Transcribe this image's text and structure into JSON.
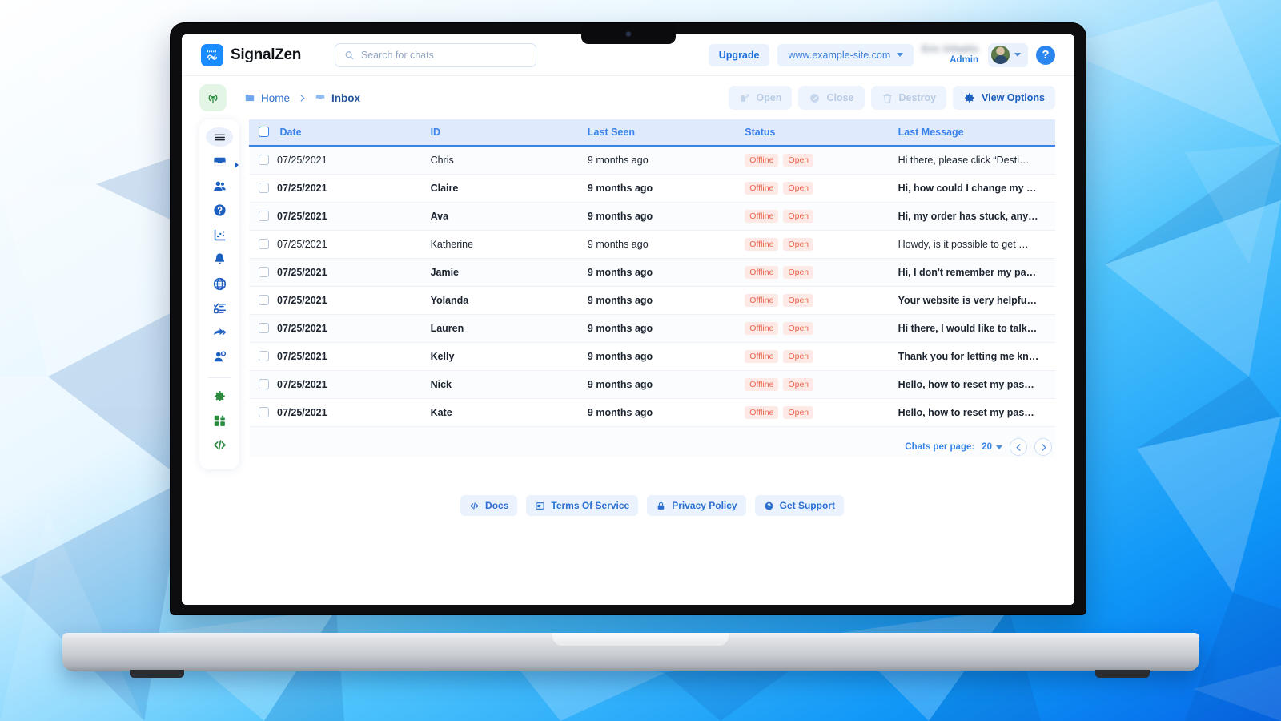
{
  "brand": {
    "name": "SignalZen",
    "logo_icon": "signalzen-logo-icon"
  },
  "search": {
    "placeholder": "Search for chats",
    "value": "",
    "icon": "search-icon"
  },
  "header": {
    "upgrade_label": "Upgrade",
    "site_label": "www.example-site.com",
    "user_name": "Eric Urbaitis",
    "user_role": "Admin",
    "help_label": "?",
    "avatar_icon": "user-avatar",
    "dropdown_icon": "chevron-down-icon"
  },
  "toolbar": {
    "signal_icon": "broadcast-signal-icon",
    "breadcrumb": [
      {
        "label": "Home",
        "icon": "folder-icon",
        "active": false
      },
      {
        "label": "Inbox",
        "icon": "inbox-icon",
        "active": true
      }
    ],
    "separator": "›",
    "actions": [
      {
        "label": "Open",
        "icon": "open-external-icon",
        "enabled": false
      },
      {
        "label": "Close",
        "icon": "check-circle-icon",
        "enabled": false
      },
      {
        "label": "Destroy",
        "icon": "trash-icon",
        "enabled": false
      },
      {
        "label": "View Options",
        "icon": "gear-icon",
        "enabled": true
      }
    ]
  },
  "sidebar": {
    "items": [
      {
        "name": "menu",
        "icon": "hamburger-menu-icon",
        "active": true,
        "color": "#1c2430",
        "has_arrow": false
      },
      {
        "name": "inbox",
        "icon": "inbox-icon",
        "active": false,
        "color": "#1d5fc0",
        "has_arrow": true
      },
      {
        "name": "visitors",
        "icon": "users-icon",
        "active": false,
        "color": "#1d5fc0",
        "has_arrow": false
      },
      {
        "name": "help",
        "icon": "question-circle-icon",
        "active": false,
        "color": "#1d5fc0",
        "has_arrow": false
      },
      {
        "name": "analytics",
        "icon": "chart-scatter-icon",
        "active": false,
        "color": "#1d5fc0",
        "has_arrow": false
      },
      {
        "name": "notifications",
        "icon": "bell-icon",
        "active": false,
        "color": "#1d5fc0",
        "has_arrow": false
      },
      {
        "name": "website",
        "icon": "globe-icon",
        "active": false,
        "color": "#1d5fc0",
        "has_arrow": false
      },
      {
        "name": "tasks",
        "icon": "checklist-icon",
        "active": false,
        "color": "#1d5fc0",
        "has_arrow": false
      },
      {
        "name": "broadcast",
        "icon": "share-forward-icon",
        "active": false,
        "color": "#1d5fc0",
        "has_arrow": false
      },
      {
        "name": "agents",
        "icon": "user-settings-icon",
        "active": false,
        "color": "#1d5fc0",
        "has_arrow": false
      },
      {
        "name": "settings",
        "icon": "gear-icon",
        "active": false,
        "color": "#2c8a3f",
        "has_arrow": false
      },
      {
        "name": "integrations",
        "icon": "puzzle-apps-icon",
        "active": false,
        "color": "#2c8a3f",
        "has_arrow": false
      },
      {
        "name": "developers",
        "icon": "code-icon",
        "active": false,
        "color": "#2c8a3f",
        "has_arrow": false
      }
    ]
  },
  "table": {
    "columns": [
      "Date",
      "ID",
      "Last Seen",
      "Status",
      "Last Message"
    ],
    "select_all_checked": false,
    "rows": [
      {
        "checked": false,
        "date": "07/25/2021",
        "id": "Chris",
        "last_seen": "9 months ago",
        "status": [
          "Offline",
          "Open"
        ],
        "message": "Hi there, please click “Desti…",
        "unread": false
      },
      {
        "checked": false,
        "date": "07/25/2021",
        "id": "Claire",
        "last_seen": "9 months ago",
        "status": [
          "Offline",
          "Open"
        ],
        "message": "Hi, how could I change my …",
        "unread": true
      },
      {
        "checked": false,
        "date": "07/25/2021",
        "id": "Ava",
        "last_seen": "9 months ago",
        "status": [
          "Offline",
          "Open"
        ],
        "message": "Hi, my order has stuck, any…",
        "unread": true
      },
      {
        "checked": false,
        "date": "07/25/2021",
        "id": "Katherine",
        "last_seen": "9 months ago",
        "status": [
          "Offline",
          "Open"
        ],
        "message": "Howdy, is it possible to get …",
        "unread": false
      },
      {
        "checked": false,
        "date": "07/25/2021",
        "id": "Jamie",
        "last_seen": "9 months ago",
        "status": [
          "Offline",
          "Open"
        ],
        "message": "Hi, I don't remember my pa…",
        "unread": true
      },
      {
        "checked": false,
        "date": "07/25/2021",
        "id": "Yolanda",
        "last_seen": "9 months ago",
        "status": [
          "Offline",
          "Open"
        ],
        "message": "Your website is very helpfu…",
        "unread": true
      },
      {
        "checked": false,
        "date": "07/25/2021",
        "id": "Lauren",
        "last_seen": "9 months ago",
        "status": [
          "Offline",
          "Open"
        ],
        "message": "Hi there, I would like to talk…",
        "unread": true
      },
      {
        "checked": false,
        "date": "07/25/2021",
        "id": "Kelly",
        "last_seen": "9 months ago",
        "status": [
          "Offline",
          "Open"
        ],
        "message": "Thank you for letting me kn…",
        "unread": true
      },
      {
        "checked": false,
        "date": "07/25/2021",
        "id": "Nick",
        "last_seen": "9 months ago",
        "status": [
          "Offline",
          "Open"
        ],
        "message": "Hello, how to reset my pas…",
        "unread": true
      },
      {
        "checked": false,
        "date": "07/25/2021",
        "id": "Kate",
        "last_seen": "9 months ago",
        "status": [
          "Offline",
          "Open"
        ],
        "message": "Hello, how to reset my pas…",
        "unread": true
      }
    ]
  },
  "pagination": {
    "label": "Chats per page:",
    "value": "20",
    "prev_icon": "chevron-left-icon",
    "next_icon": "chevron-right-icon"
  },
  "footer": {
    "links": [
      {
        "label": "Docs",
        "icon": "code-icon"
      },
      {
        "label": "Terms Of Service",
        "icon": "document-icon"
      },
      {
        "label": "Privacy Policy",
        "icon": "lock-icon"
      },
      {
        "label": "Get Support",
        "icon": "question-circle-icon"
      }
    ]
  },
  "colors": {
    "brand_blue": "#1a8cff",
    "accent_blue": "#3b82e8",
    "header_bg": "#dfeafc",
    "badge_text": "#e8654f",
    "badge_bg": "#fdeae6",
    "green": "#2c8a3f"
  }
}
